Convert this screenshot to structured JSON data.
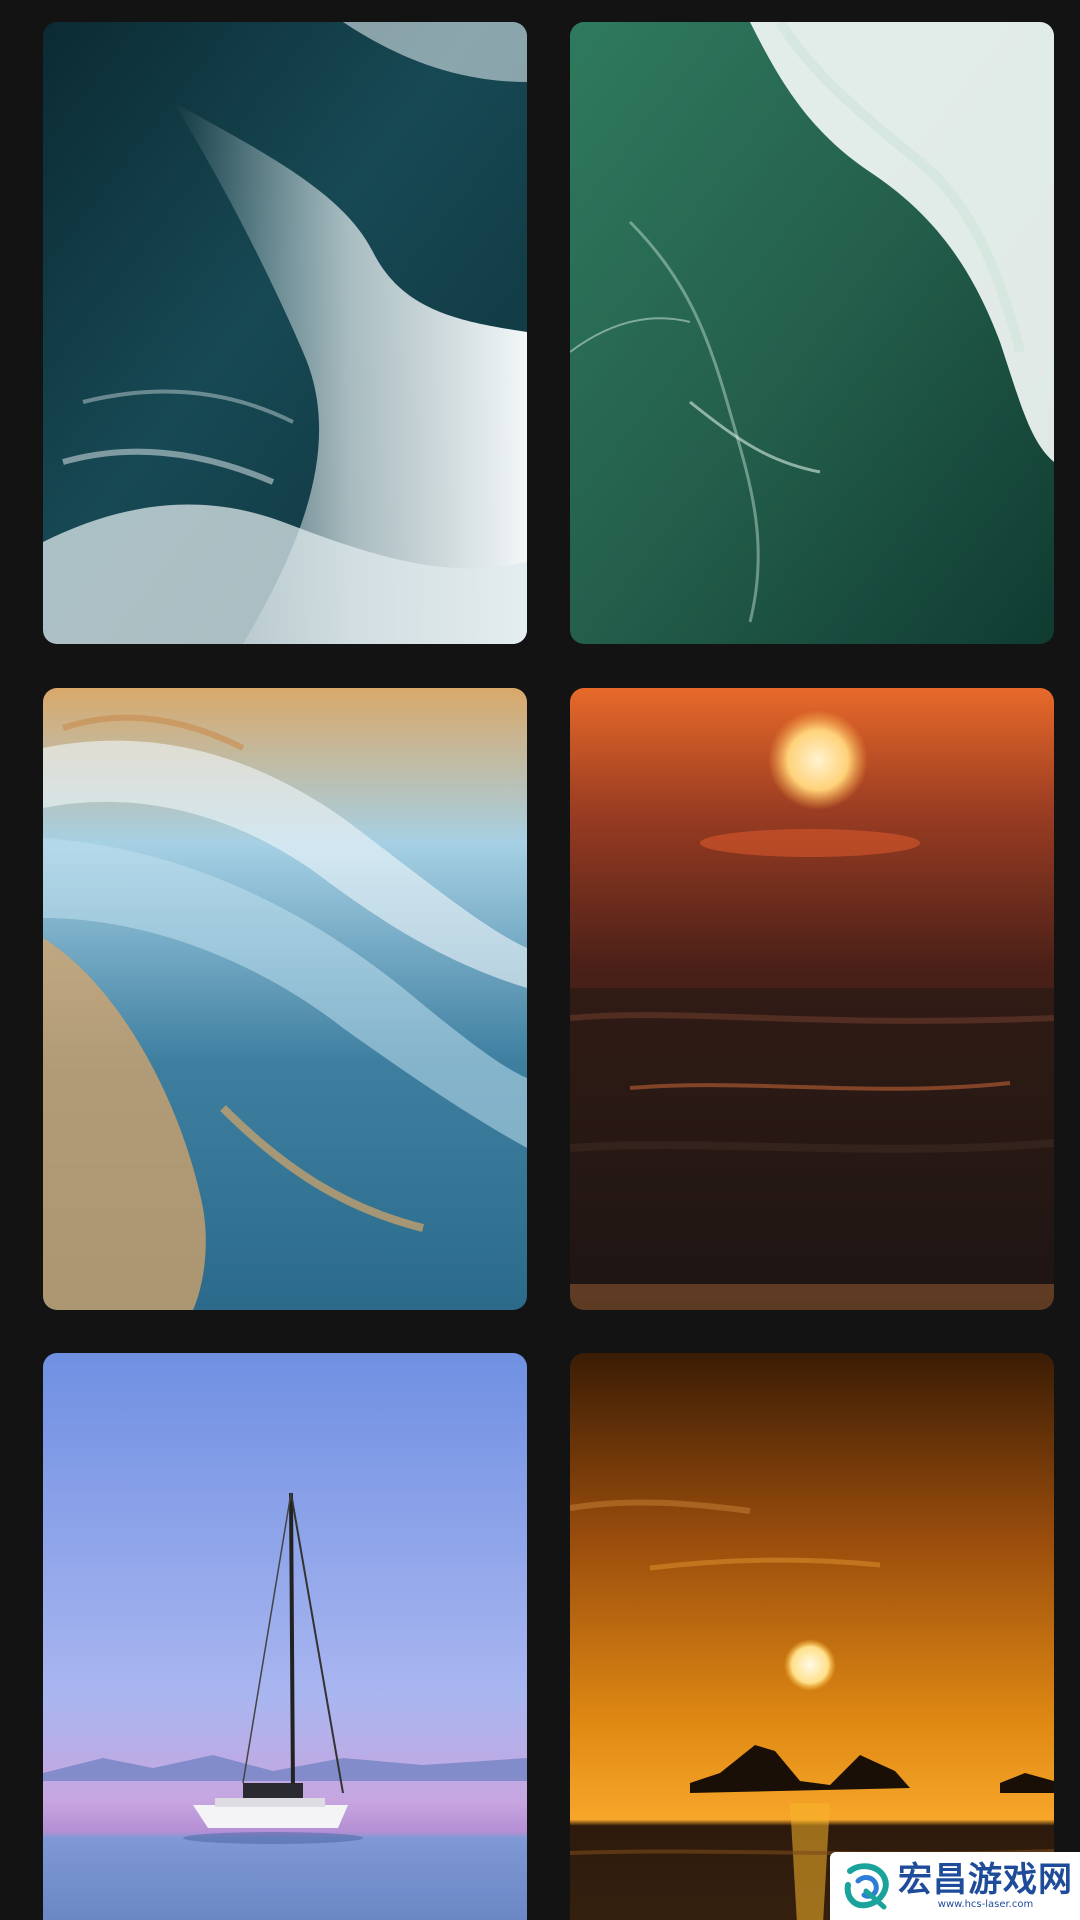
{
  "gallery": {
    "items": [
      {
        "subject": "Dark teal ocean wave with white foam",
        "colors": [
          "#0b2a33",
          "#1d5a66",
          "#e8f0f2"
        ]
      },
      {
        "subject": "Aerial view of green sea with breaking surf",
        "colors": [
          "#0f3b31",
          "#2f7a5e",
          "#f2f7f5"
        ]
      },
      {
        "subject": "Abstract blue and gold liquid wave",
        "colors": [
          "#3e7fa0",
          "#a6d0e4",
          "#d9a86a"
        ]
      },
      {
        "subject": "Orange sunset over dark sea",
        "colors": [
          "#e86a2a",
          "#4a2018",
          "#1b1412"
        ]
      },
      {
        "subject": "Sailboat on calm water at dusk",
        "colors": [
          "#6f90e2",
          "#c7c2f0",
          "#5d7bb8"
        ]
      },
      {
        "subject": "Golden sunset with rocks silhouetted",
        "colors": [
          "#3a1c05",
          "#e08a14",
          "#f7b52a"
        ]
      }
    ]
  },
  "watermark": {
    "title": "宏昌游戏网",
    "url": "www.hcs-laser.com"
  }
}
